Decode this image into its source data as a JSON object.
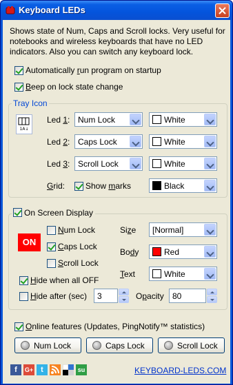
{
  "window": {
    "title": "Keyboard LEDs",
    "description": "Shows state of Num, Caps and Scroll locks. Very useful for notebooks and wireless keyboards that have no LED indicators. Also you can switch any keyboard lock."
  },
  "options": {
    "autorun": {
      "pre": "Automatically ",
      "u": "r",
      "post": "un program on startup",
      "checked": true
    },
    "beep": {
      "pre": "",
      "u": "B",
      "post": "eep on lock state change",
      "checked": true
    }
  },
  "tray": {
    "title": "Tray Icon",
    "led1": {
      "label_pre": "Led ",
      "label_u": "1",
      "label_post": ":",
      "key": "Num Lock",
      "color": "White",
      "color_hex": "#ffffff"
    },
    "led2": {
      "label_pre": "Led ",
      "label_u": "2",
      "label_post": ":",
      "key": "Caps Lock",
      "color": "White",
      "color_hex": "#ffffff"
    },
    "led3": {
      "label_pre": "Led ",
      "label_u": "3",
      "label_post": ":",
      "key": "Scroll Lock",
      "color": "White",
      "color_hex": "#ffffff"
    },
    "grid": {
      "label_u": "G",
      "label_post": "rid:",
      "show_marks": "Show ",
      "show_marks_u": "m",
      "show_marks_post": "arks",
      "checked": true,
      "color": "Black",
      "color_hex": "#000000"
    }
  },
  "osd": {
    "title": "On Screen Display",
    "checked": true,
    "badge": "ON",
    "badge_color": "#ff0000",
    "num_lock": {
      "u": "N",
      "post": "um Lock",
      "checked": false
    },
    "caps_lock": {
      "u": "C",
      "post": "aps Lock",
      "checked": true
    },
    "scroll_lock": {
      "u": "S",
      "post": "croll Lock",
      "checked": false
    },
    "size": {
      "pre": "Si",
      "u": "z",
      "post": "e",
      "value": "[Normal]"
    },
    "body": {
      "pre": "Bo",
      "u": "d",
      "post": "y",
      "value": "Red",
      "color_hex": "#ff0000"
    },
    "text": {
      "u": "T",
      "post": "ext",
      "value": "White",
      "color_hex": "#ffffff"
    },
    "hide_all_off": {
      "u": "H",
      "post": "ide when all OFF",
      "checked": true
    },
    "hide_after": {
      "u": "H",
      "post": "ide after (sec)",
      "checked": false,
      "value": "3"
    },
    "opacity": {
      "pre": "O",
      "u": "p",
      "post": "acity",
      "value": "80"
    }
  },
  "footer": {
    "online": {
      "u": "O",
      "post": "nline features (Updates, PingNotify™ statistics)",
      "checked": true
    },
    "buttons": [
      "Num Lock",
      "Caps Lock",
      "Scroll Lock"
    ],
    "site_link": "KEYBOARD-LEDS.COM",
    "social_icons": [
      "facebook-icon",
      "google-plus-icon",
      "twitter-icon",
      "rss-icon",
      "delicious-icon",
      "stumbleupon-icon"
    ]
  }
}
